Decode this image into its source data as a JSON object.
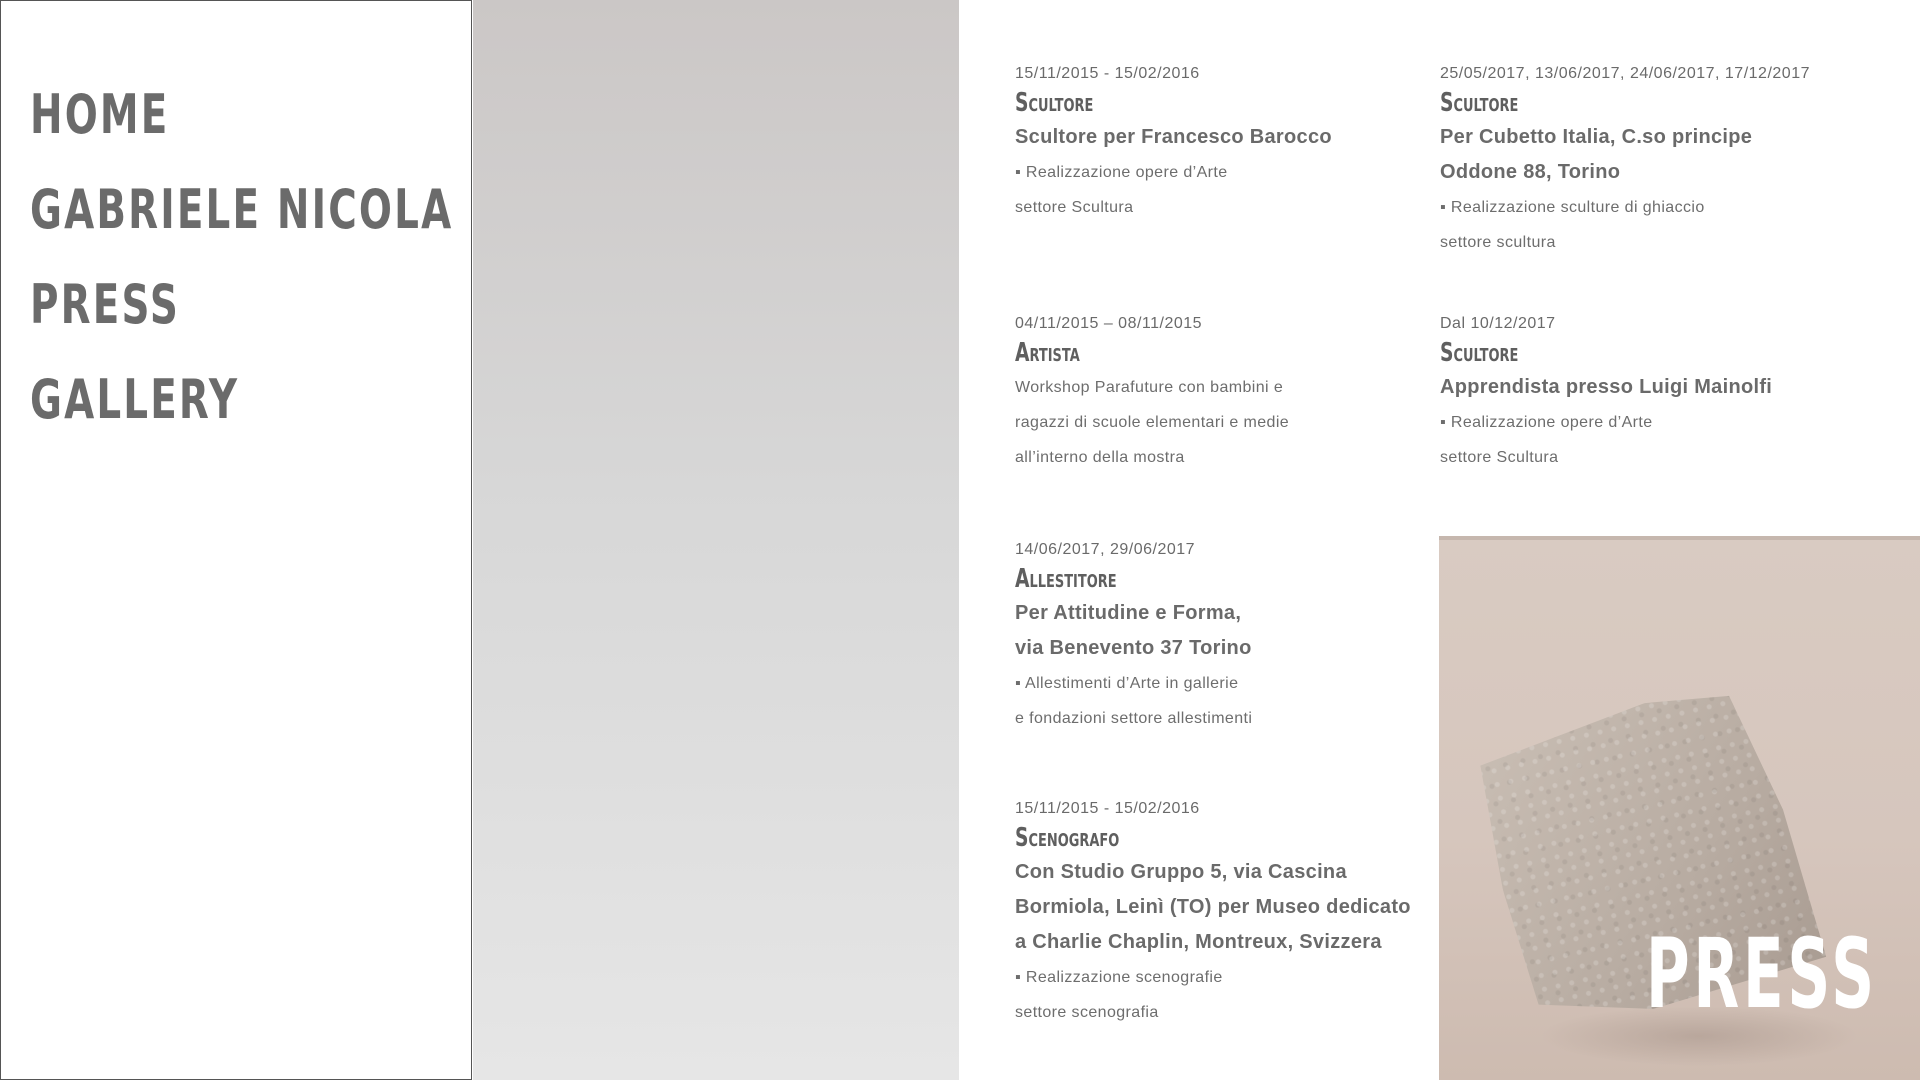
{
  "nav": {
    "items": [
      {
        "label": "HOME"
      },
      {
        "label": "GABRIELE NICOLA"
      },
      {
        "label": "PRESS"
      },
      {
        "label": "GALLERY"
      }
    ]
  },
  "entries": [
    {
      "date": "15/11/2015 - 15/02/2016",
      "role": "Scultore",
      "subtitle": "Scultore per Francesco Barocco",
      "detail": "▪ Realizzazione opere d’Arte\nsettore Scultura"
    },
    {
      "date": "25/05/2017, 13/06/2017, 24/06/2017, 17/12/2017",
      "role": "Scultore",
      "subtitle": "Per Cubetto Italia, C.so principe\nOddone 88, Torino",
      "detail": "▪ Realizzazione sculture di ghiaccio\nsettore scultura"
    },
    {
      "date": "04/11/2015 – 08/11/2015",
      "role": "Artista",
      "subtitle": "",
      "detail": "Workshop Parafuture con bambini e\nragazzi di scuole elementari e medie\nall’interno della mostra"
    },
    {
      "date": "Dal 10/12/2017",
      "role": "Scultore",
      "subtitle": "Apprendista presso Luigi Mainolfi",
      "detail": "▪ Realizzazione opere d’Arte\nsettore Scultura"
    },
    {
      "date": "14/06/2017, 29/06/2017",
      "role": "Allestitore",
      "subtitle": "Per Attitudine e Forma,\nvia Benevento 37 Torino",
      "detail": "▪ Allestimenti d’Arte in gallerie\ne fondazioni settore allestimenti"
    },
    {
      "date": "15/11/2015 - 15/02/2016",
      "role": "Scenografo",
      "subtitle": "Con Studio Gruppo 5, via Cascina\nBormiola, Leinì (TO) per Museo dedicato\na Charlie Chaplin, Montreux, Svizzera",
      "detail": "▪ Realizzazione scenografie\nsettore scenografia"
    }
  ],
  "press_card": {
    "title": "PRESS"
  },
  "colors": {
    "text": "#6b6b6b",
    "gray_column_top": "#cbc7c6",
    "gray_column_bottom": "#e6e6e6",
    "press_bg": "#d6c6bd"
  }
}
